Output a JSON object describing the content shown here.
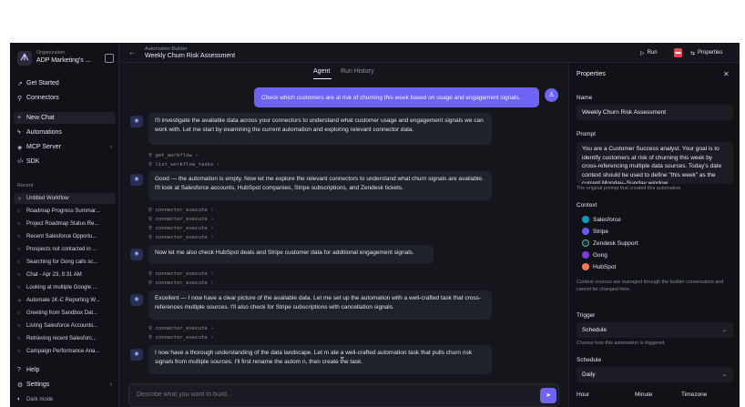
{
  "sidebar": {
    "org_label": "Organization",
    "org_name": "ADP Marketing's ...",
    "nav": [
      {
        "label": "Get Started",
        "icon": "rocket-icon"
      },
      {
        "label": "Connectors",
        "icon": "plug-icon"
      },
      {
        "label": "New Chat",
        "icon": "plus-icon"
      },
      {
        "label": "Automations",
        "icon": "zap-icon"
      },
      {
        "label": "MCP Server",
        "icon": "server-icon"
      },
      {
        "label": "SDK",
        "icon": "code-icon"
      }
    ],
    "recent_label": "Recent",
    "recent": [
      "Untitled Workflow",
      "Roadmap Progress Summar...",
      "Project Roadmap Status Re...",
      "Recent Salesforce Opportu...",
      "Prospects not contacted in ...",
      "Searching for Gong calls sc...",
      "Chat - Apr 23, 9:31 AM",
      "Looking at multiple Google ...",
      "Automate 1K-C Reporting W...",
      "Greeting from Sandbox Dat...",
      "Listing Salesforce Accounts...",
      "Retrieving recent Salesforc...",
      "Campaign Performance Ana..."
    ],
    "help": "Help",
    "settings": "Settings",
    "dark_mode": "Dark mode"
  },
  "topbar": {
    "breadcrumb": "Automation Builder",
    "title": "Weekly Churn Risk Assessment",
    "run": "Run",
    "properties": "Properties"
  },
  "tabs": [
    "Agent",
    "Run History"
  ],
  "chat": {
    "user_message": "Check which customers are at risk of churning this week based on usage and engagement signals.",
    "messages": [
      "I'll investigate the available data across your connectors to understand what customer usage and engagement signals we can work with. Let me start by examining the current automation and exploring relevant connector data.",
      "Good — the automation is empty. Now let me explore the relevant connectors to understand what churn signals are available. I'll look at Salesforce accounts, HubSpot companies, Stripe subscriptions, and Zendesk tickets.",
      "Now let me also check HubSpot deals and Stripe customer data for additional engagement signals.",
      "Excellent — I now have a clear picture of the available data. Let me set up the automation with a well-crafted task that cross-references multiple sources. I'll also check for Stripe subscriptions with cancellation signals.",
      "I now have a thorough understanding of the data landscape. Let m    ate a well-crafted automation task that pulls churn risk signals from multiple sources. I'll first rename the autom    n, then create the task."
    ],
    "tool_groups": [
      [
        "get_workflow",
        "list_workflow_tasks"
      ],
      [
        "connector_execute",
        "connector_execute",
        "connector_execute",
        "connector_execute"
      ],
      [
        "connector_execute",
        "connector_execute"
      ],
      [
        "connector_execute",
        "connector_execute"
      ]
    ],
    "composer_placeholder": "Describe what you want to build..."
  },
  "panel": {
    "title": "Properties",
    "name_label": "Name",
    "name_value": "Weekly Churn Risk Assessment",
    "prompt_label": "Prompt",
    "prompt_value": "You are a Customer Success analyst. Your goal is to identify customers at risk of churning this week by cross-referencing multiple data sources. Today's date context should be used to define \"this week\" as the current Monday–Sunday window.",
    "prompt_help": "The original prompt that created this automation",
    "context_label": "Context",
    "sources": [
      {
        "name": "Salesforce",
        "color": "#1798c1"
      },
      {
        "name": "Stripe",
        "color": "#635bff"
      },
      {
        "name": "Zendesk Support",
        "color": "#03363d"
      },
      {
        "name": "Gong",
        "color": "#8039df"
      },
      {
        "name": "HubSpot",
        "color": "#ff7a59"
      }
    ],
    "context_help": "Context sources are managed through the builder conversation and cannot be changed here.",
    "trigger_label": "Trigger",
    "trigger_value": "Schedule",
    "trigger_help": "Choose how this automation is triggered.",
    "schedule_label": "Schedule",
    "schedule_value": "Daily",
    "hour_label": "Hour",
    "minute_label": "Minute",
    "timezone_label": "Timezone"
  }
}
